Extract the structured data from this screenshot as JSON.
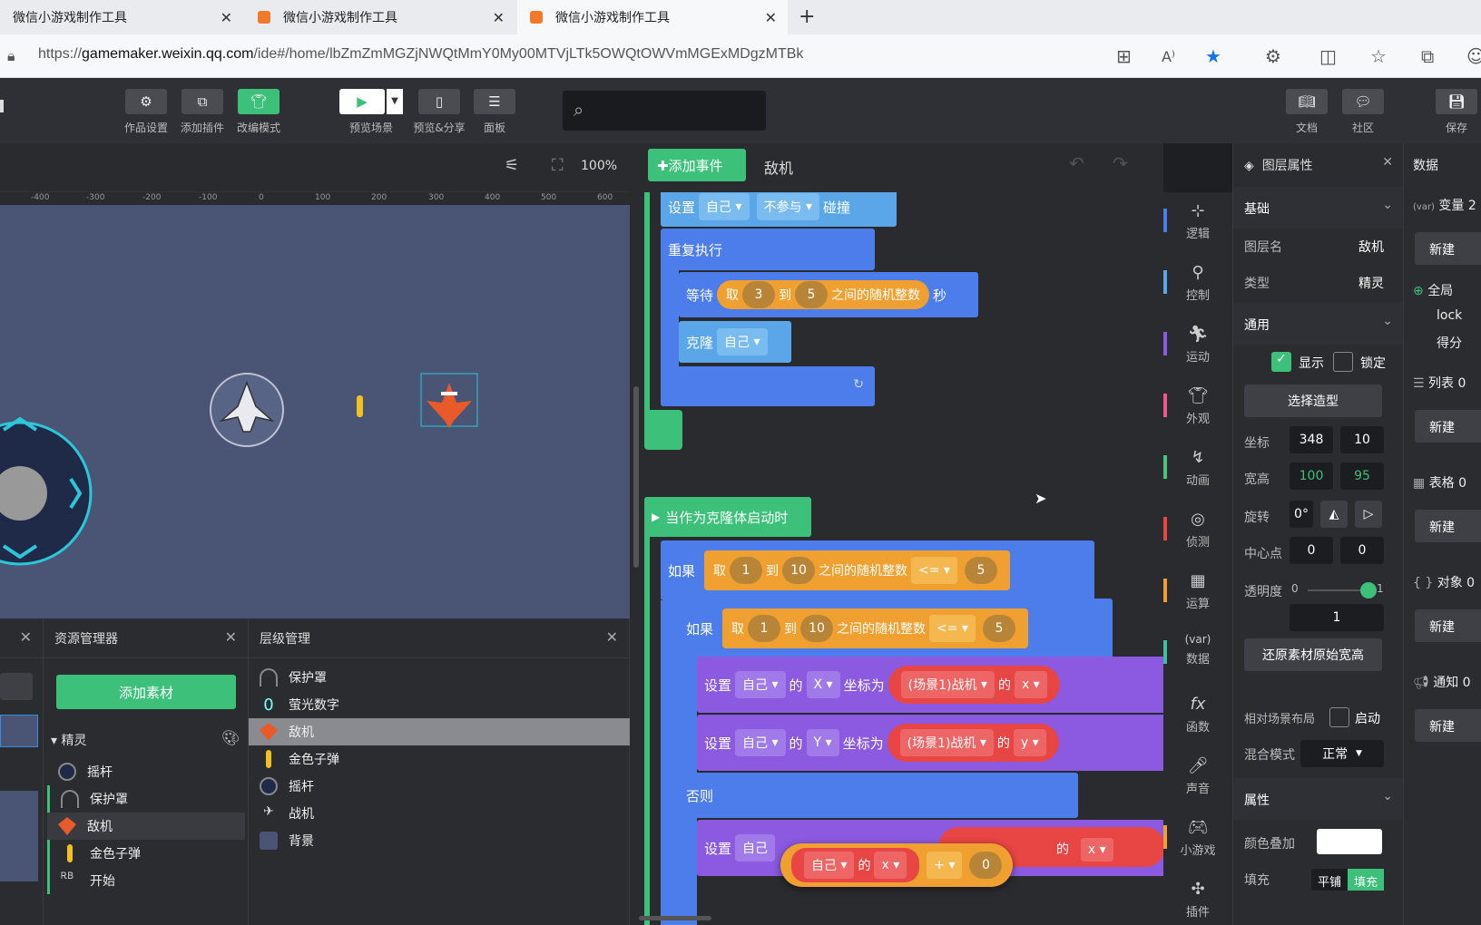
{
  "browser": {
    "tabs": [
      {
        "title": "微信小游戏制作工具"
      },
      {
        "title": "微信小游戏制作工具"
      },
      {
        "title": "微信小游戏制作工具"
      }
    ],
    "url_prefix": "https://",
    "url_host": "gamemaker.weixin.qq.com",
    "url_path": "/ide#/home/lbZmZmMGZjNWQtMmY0My00MTVjLTk5OWQtOWVmMGExMDgzMTBk"
  },
  "toolbar": {
    "work_settings": "作品设置",
    "add_plugin": "添加插件",
    "edit_mode": "改编模式",
    "preview_scene": "预览场景",
    "preview_share": "预览&分享",
    "panel": "面板",
    "docs": "文档",
    "community": "社区",
    "save": "保存"
  },
  "stage": {
    "zoom": "100%",
    "ruler_labels": [
      "-400",
      "-300",
      "-200",
      "-100",
      "0",
      "100",
      "200",
      "300",
      "400",
      "500",
      "600"
    ]
  },
  "resources": {
    "title": "资源管理器",
    "add_button": "添加素材",
    "group": "精灵",
    "items": [
      "摇杆",
      "保护罩",
      "敌机",
      "金色子弹",
      "开始"
    ]
  },
  "layers": {
    "title": "层级管理",
    "items": [
      "保护罩",
      "萤光数字",
      "敌机",
      "金色子弹",
      "摇杆",
      "战机",
      "背景"
    ]
  },
  "code": {
    "add_event": "添加事件",
    "object_name": "敌机",
    "set_label": "设置",
    "self": "自己",
    "not_participate": "不参与",
    "collide": "碰撞",
    "repeat": "重复执行",
    "wait": "等待",
    "take": "取",
    "to": "到",
    "random_int": "之间的随机整数",
    "seconds": "秒",
    "clone": "克隆",
    "clone_start": "当作为克隆体启动时",
    "if": "如果",
    "else": "否则",
    "of": "的",
    "coord_as": "坐标为",
    "scene_fighter": "(场景1)战机",
    "le": "<=",
    "x_axis": "X",
    "y_axis": "Y",
    "x": "x",
    "y": "y",
    "plus": "+",
    "n1": "1",
    "n3": "3",
    "n5": "5",
    "n10": "10",
    "n0": "0"
  },
  "categories": [
    {
      "label": "逻辑",
      "color": "#4c7dea"
    },
    {
      "label": "控制",
      "color": "#5aa6e8"
    },
    {
      "label": "运动",
      "color": "#8b5ae0"
    },
    {
      "label": "外观",
      "color": "#e85a8a"
    },
    {
      "label": "动画",
      "color": "#4ac27a"
    },
    {
      "label": "侦测",
      "color": "#e84545"
    },
    {
      "label": "运算",
      "color": "#f0a030"
    },
    {
      "label": "数据",
      "color": "#3ec0a0"
    },
    {
      "label": "函数",
      "color": "#2a2b2f"
    },
    {
      "label": "声音",
      "color": "#2a2b2f"
    },
    {
      "label": "小游戏",
      "color": "#f0a030"
    },
    {
      "label": "插件",
      "color": "#2a2b2f"
    }
  ],
  "props": {
    "title": "图层属性",
    "basic": "基础",
    "layer_name_label": "图层名",
    "layer_name": "敌机",
    "type_label": "类型",
    "type": "精灵",
    "general": "通用",
    "show": "显示",
    "lock": "锁定",
    "choose_shape": "选择造型",
    "coord_label": "坐标",
    "x": "348",
    "y": "10",
    "size_label": "宽高",
    "w": "100",
    "h": "95",
    "rotate_label": "旋转",
    "rotate": "0°",
    "center_label": "中心点",
    "cx": "0",
    "cy": "0",
    "opacity_label": "透明度",
    "opacity_min": "0",
    "opacity_max": "1",
    "opacity": "1",
    "restore": "还原素材原始宽高",
    "relative_layout": "相对场景布局",
    "enable": "启动",
    "blend_label": "混合模式",
    "blend": "正常",
    "attrs": "属性",
    "color_overlay": "颜色叠加",
    "fill_label": "填充",
    "fill_tile": "平铺",
    "fill_fill": "填充"
  },
  "data_panel": {
    "title": "数据",
    "vars": "变量 2",
    "new": "新建",
    "global": "全局",
    "var1": "lock",
    "var2": "得分",
    "list": "列表 0",
    "table": "表格 0",
    "object": "对象 0",
    "notify": "通知 0"
  }
}
